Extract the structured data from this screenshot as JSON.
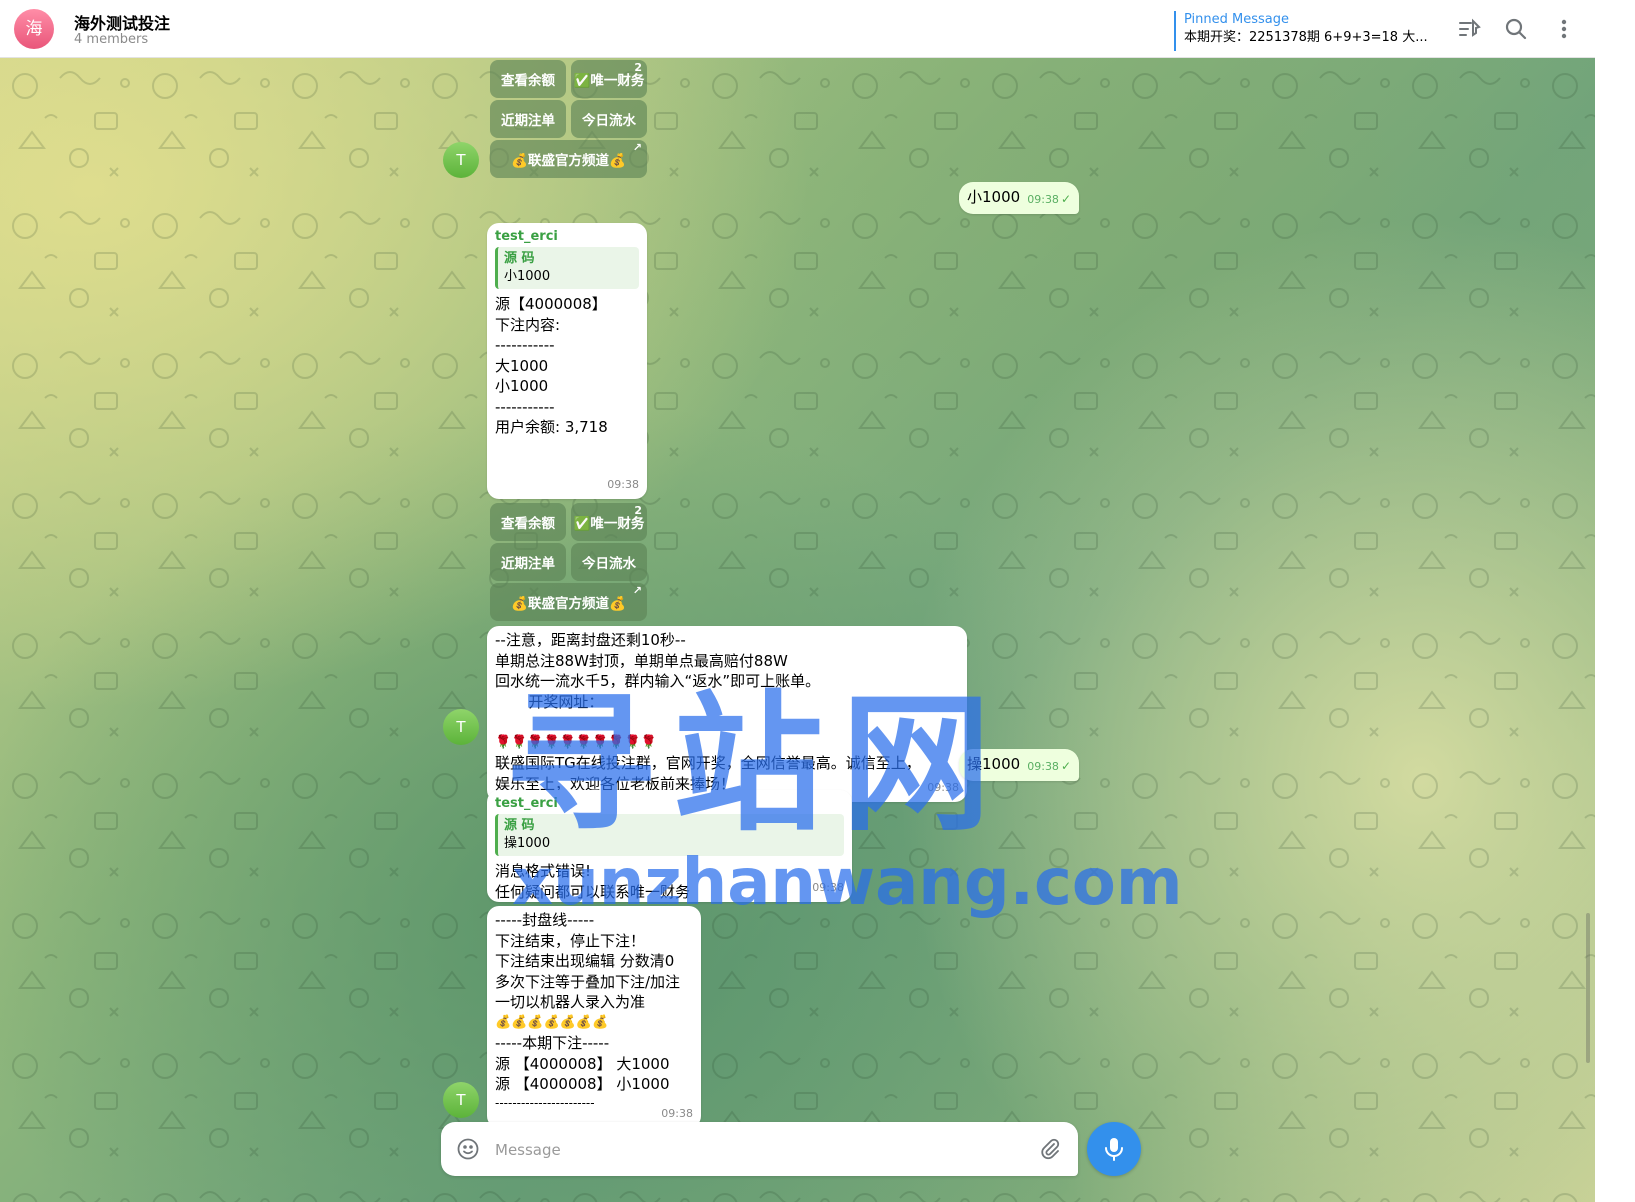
{
  "header": {
    "avatar_letter": "海",
    "title": "海外测试投注",
    "members": "4 members",
    "pinned_label": "Pinned Message",
    "pinned_text": "本期开奖：2251378期 6+9+3=18 大..."
  },
  "keyboard": {
    "balance": "查看余额",
    "finance": "✅唯一财务",
    "recent_bets": "近期注单",
    "today_flow": "今日流水",
    "channel": "💰联盛官方频道💰",
    "corner_2": "2",
    "corner_arrow": "↗"
  },
  "avatar_letter": "T",
  "messages": {
    "m1": {
      "text": "小1000",
      "time": "09:38"
    },
    "m2": {
      "sender": "test_erci",
      "reply_title": "源 码",
      "reply_text": "小1000",
      "lines": [
        "源【4000008】",
        "下注内容:",
        "-----------",
        "大1000",
        "小1000",
        "-----------",
        "用户余额: 3,718"
      ],
      "time": "09:38"
    },
    "m3": {
      "lines": [
        "--注意，距离封盘还剩10秒--",
        "单期总注88W封顶，单期单点最高赔付88W",
        "回水统一流水千5，群内输入“返水”即可上账单。",
        "       开奖网址：",
        "",
        "🌹🌹🌹🌹🌹🌹🌹🌹🌹🌹",
        "联盛国际TG在线投注群，官网开奖，全网信誉最高。诚信至上，",
        "娱乐至上，欢迎各位老板前来捧场！"
      ],
      "time": "09:38"
    },
    "m4": {
      "text": "操1000",
      "time": "09:38"
    },
    "m5": {
      "sender": "test_erci",
      "reply_title": "源 码",
      "reply_text": "操1000",
      "lines": [
        "消息格式错误!",
        "任何疑问都可以联系唯一财务"
      ],
      "time": "09:38"
    },
    "m6": {
      "lines": [
        "-----封盘线-----",
        "下注结束，停止下注！",
        "下注结束出现编辑 分数清0",
        "多次下注等于叠加下注/加注",
        "一切以机器人录入为准",
        "💰💰💰💰💰💰💰",
        "-----本期下注-----",
        "源 【4000008】 大1000",
        "源 【4000008】 小1000",
        "-----------------------"
      ],
      "time": "09:38"
    }
  },
  "composer": {
    "placeholder": "Message"
  },
  "watermark": {
    "line1": "寻站网",
    "line2": "xunzhanwang.com"
  }
}
